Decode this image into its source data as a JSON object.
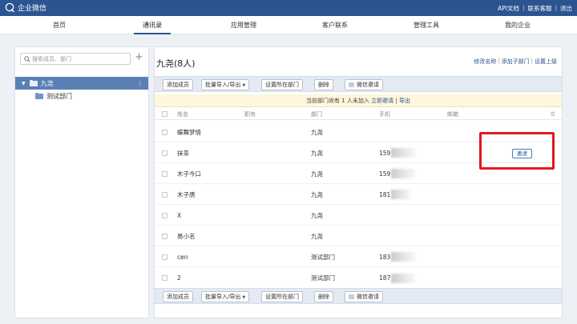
{
  "app": {
    "title": "企业微信",
    "top_links": [
      "API文档",
      "联系客服",
      "退出"
    ]
  },
  "nav": {
    "tabs": [
      "首页",
      "通讯录",
      "应用管理",
      "客户联系",
      "管理工具",
      "我的企业"
    ],
    "active": "通讯录"
  },
  "sidebar": {
    "search_placeholder": "搜索成员、部门",
    "add_symbol": "+",
    "root": "九尧",
    "root_menu": "⋮",
    "child": "测试部门"
  },
  "main": {
    "title": "九尧(8人)",
    "actions": [
      "修改名称",
      "添加子部门",
      "设置上级"
    ],
    "toolbar": {
      "add_member": "添加成员",
      "batch": "批量导入/导出",
      "set_dept": "设置所在部门",
      "delete": "删除",
      "wechat_invite": "微信邀请"
    },
    "notice": {
      "text": "当前部门尚有 1 人未加入",
      "link1": "立即邀请",
      "sep": "|",
      "link2": "导出"
    },
    "columns": [
      "姓名",
      "职务",
      "部门",
      "手机",
      "邮箱"
    ],
    "invite_label": "邀请",
    "rows": [
      {
        "name": "蝶舞梦情",
        "title": "",
        "dept": "九尧",
        "phone": ""
      },
      {
        "name": "抹茶",
        "title": "",
        "dept": "九尧",
        "phone": "159"
      },
      {
        "name": "木子今口",
        "title": "",
        "dept": "九尧",
        "phone": "159"
      },
      {
        "name": "木子唐",
        "title": "",
        "dept": "九尧",
        "phone": "181"
      },
      {
        "name": "X",
        "title": "",
        "dept": "九尧",
        "phone": ""
      },
      {
        "name": "易小名",
        "title": "",
        "dept": "九尧",
        "phone": ""
      },
      {
        "name": "cen",
        "title": "",
        "dept": "测试部门",
        "phone": "183"
      },
      {
        "name": "2",
        "title": "",
        "dept": "测试部门",
        "phone": "187"
      }
    ]
  },
  "colors": {
    "brand": "#2b5490",
    "highlight": "#e0191e",
    "tree_selected": "#5a7fb5"
  }
}
